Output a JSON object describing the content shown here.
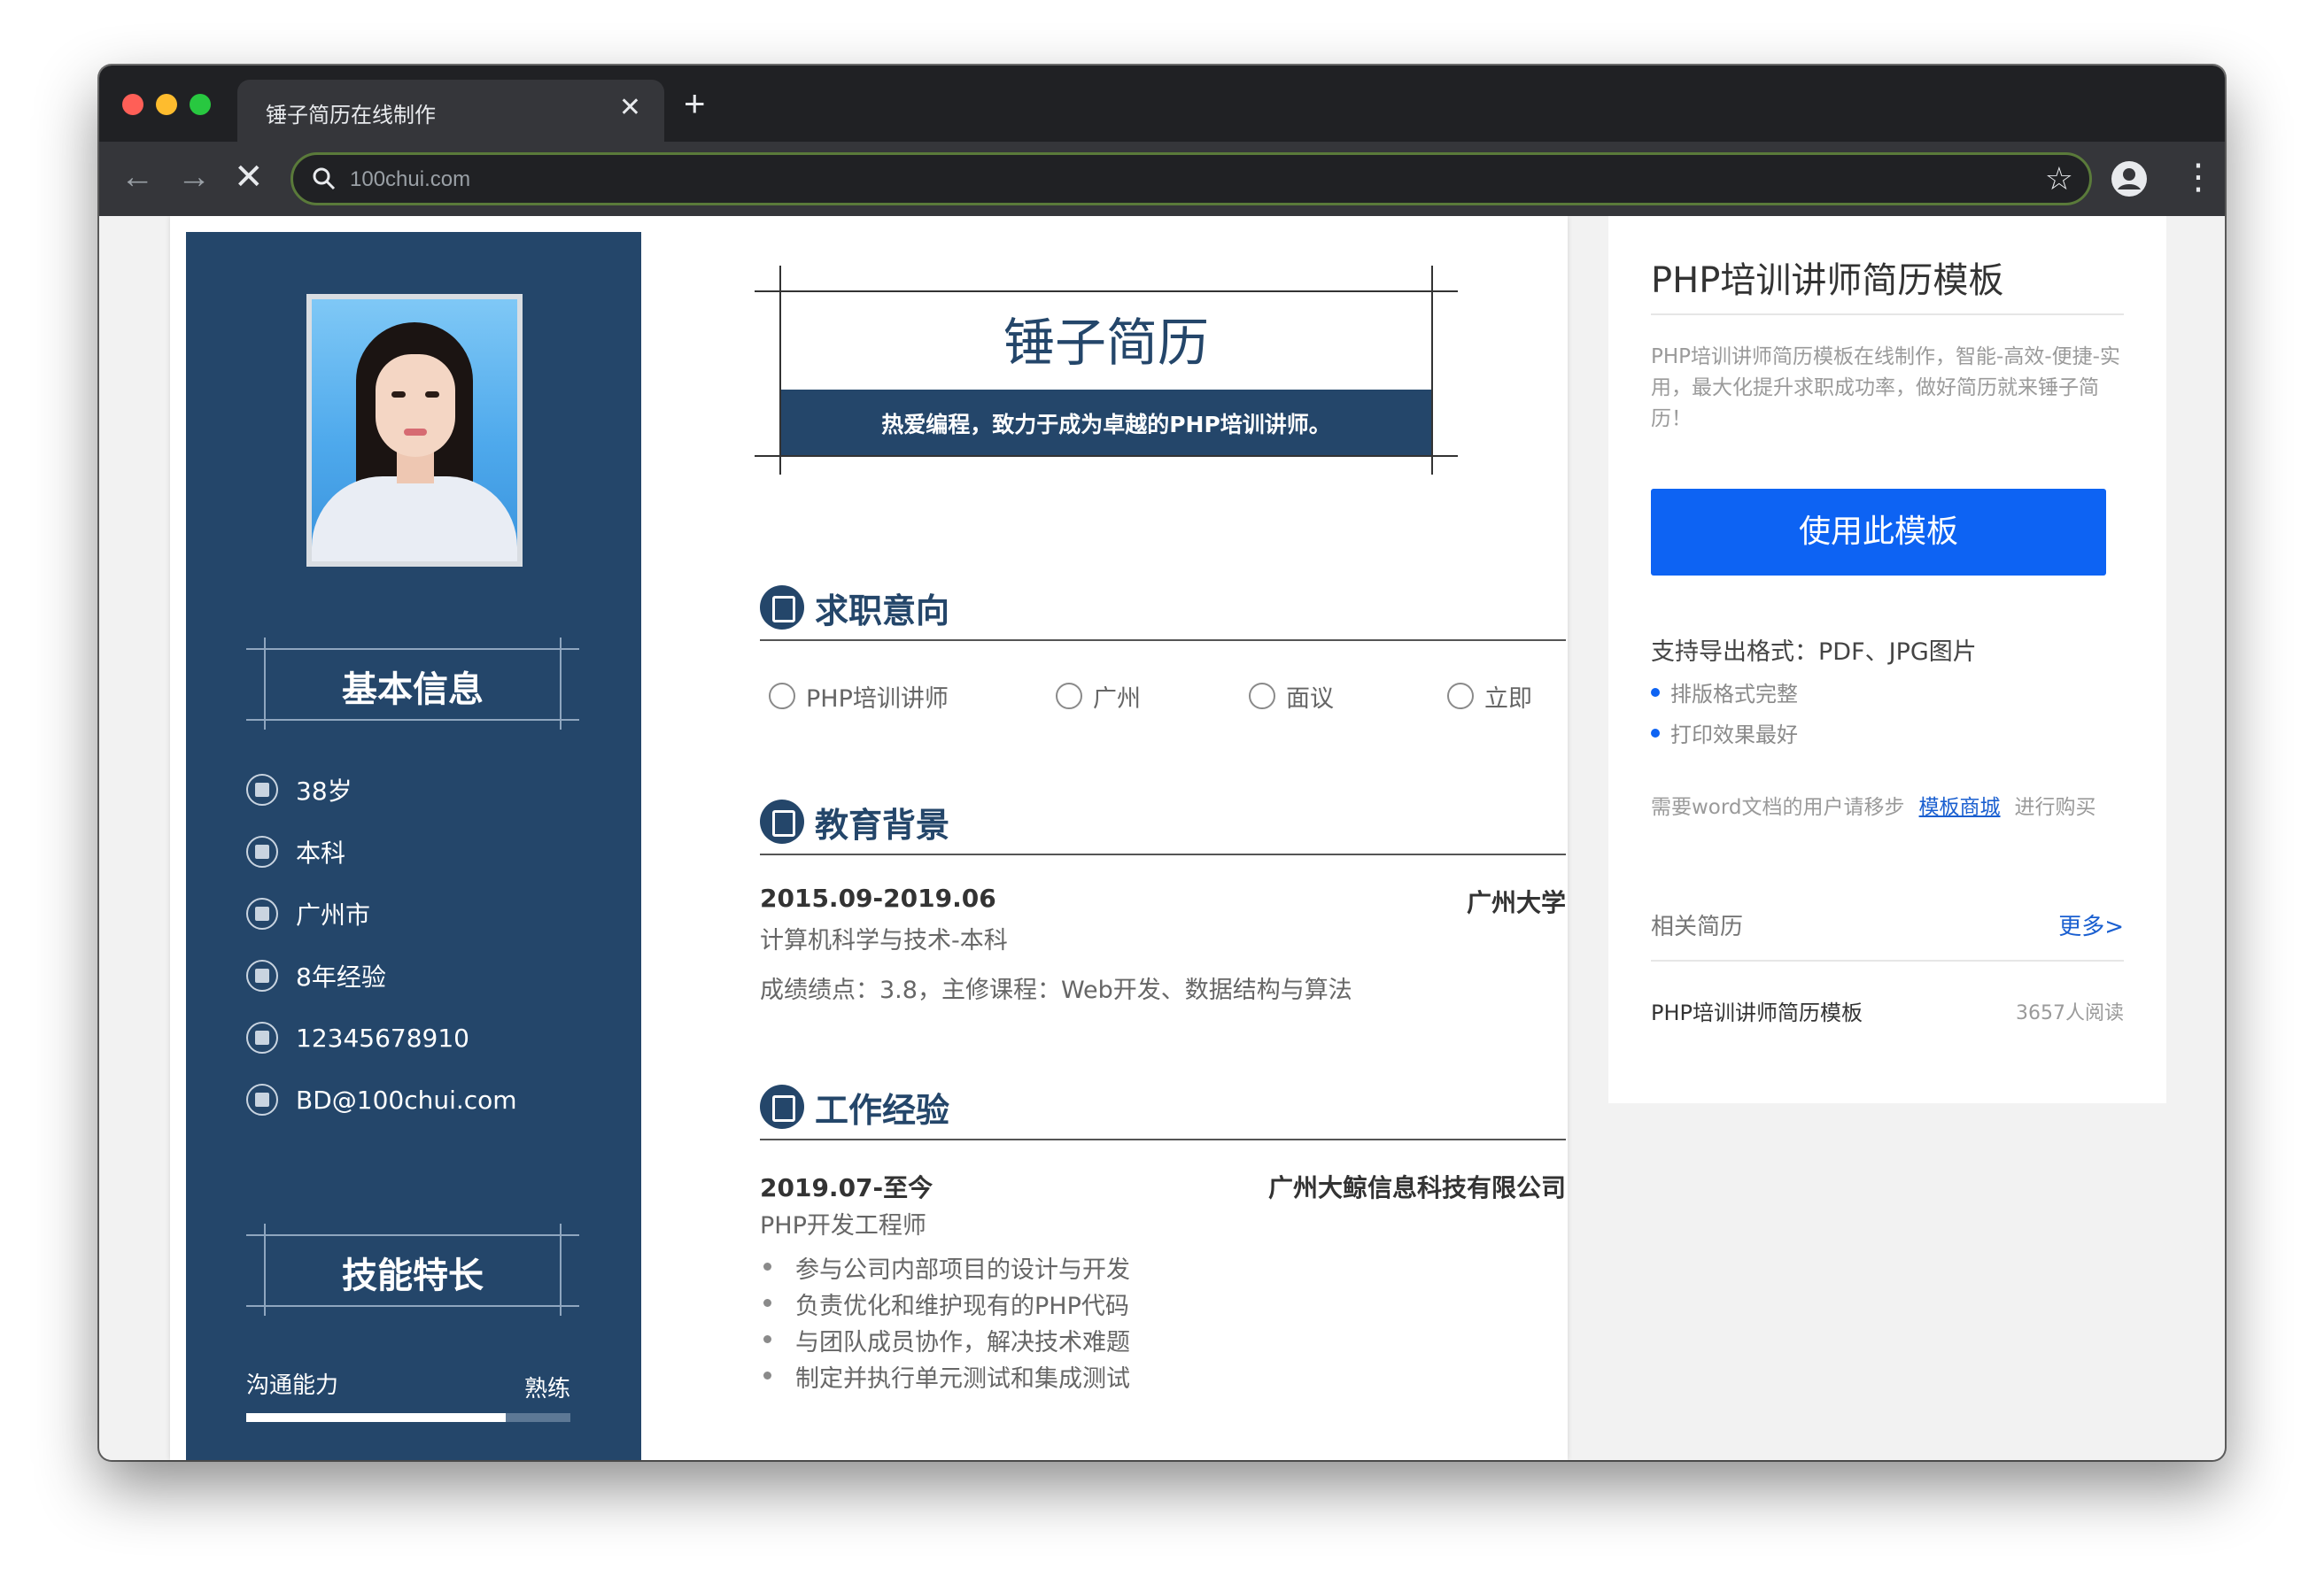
{
  "browser": {
    "tab_title": "锤子简历在线制作",
    "url": "100chui.com"
  },
  "resume": {
    "name": "锤子简历",
    "slogan": "热爱编程，致力于成为卓越的PHP培训讲师。",
    "sidebar": {
      "basic_heading": "基本信息",
      "info": [
        {
          "icon": "calendar-icon",
          "text": "38岁"
        },
        {
          "icon": "graduation-icon",
          "text": "本科"
        },
        {
          "icon": "building-icon",
          "text": "广州市"
        },
        {
          "icon": "briefcase-icon",
          "text": "8年经验"
        },
        {
          "icon": "phone-icon",
          "text": "12345678910"
        },
        {
          "icon": "mail-icon",
          "text": "BD@100chui.com"
        }
      ],
      "skills_heading": "技能特长",
      "skills": [
        {
          "name": "沟通能力",
          "level": "熟练",
          "progress": 0.8
        }
      ]
    },
    "job_intent": {
      "title": "求职意向",
      "items": [
        {
          "icon": "tie-icon",
          "text": "PHP培训讲师"
        },
        {
          "icon": "city-icon",
          "text": "广州"
        },
        {
          "icon": "yuan-icon",
          "text": "面议"
        },
        {
          "icon": "clock-icon",
          "text": "立即"
        }
      ]
    },
    "education": {
      "title": "教育背景",
      "period": "2015.09-2019.06",
      "school": "广州大学",
      "major": "计算机科学与技术-本科",
      "detail": "成绩绩点：3.8，主修课程：Web开发、数据结构与算法"
    },
    "work": {
      "title": "工作经验",
      "period": "2019.07-至今",
      "company": "广州大鲸信息科技有限公司",
      "position": "PHP开发工程师",
      "duties": [
        "参与公司内部项目的设计与开发",
        "负责优化和维护现有的PHP代码",
        "与团队成员协作，解决技术难题",
        "制定并执行单元测试和集成测试"
      ]
    }
  },
  "card": {
    "title": "PHP培训讲师简历模板",
    "description": "PHP培训讲师简历模板在线制作，智能-高效-便捷-实用，最大化提升求职成功率，做好简历就来锤子简历！",
    "use_button": "使用此模板",
    "export_label": "支持导出格式：PDF、JPG图片",
    "features": [
      "排版格式完整",
      "打印效果最好"
    ],
    "word_note_prefix": "需要word文档的用户请移步",
    "word_note_link": "模板商城",
    "word_note_suffix": "进行购买",
    "related_label": "相关简历",
    "more_link": "更多>",
    "related": [
      {
        "title": "PHP培训讲师简历模板",
        "reads": "3657人阅读"
      }
    ]
  }
}
